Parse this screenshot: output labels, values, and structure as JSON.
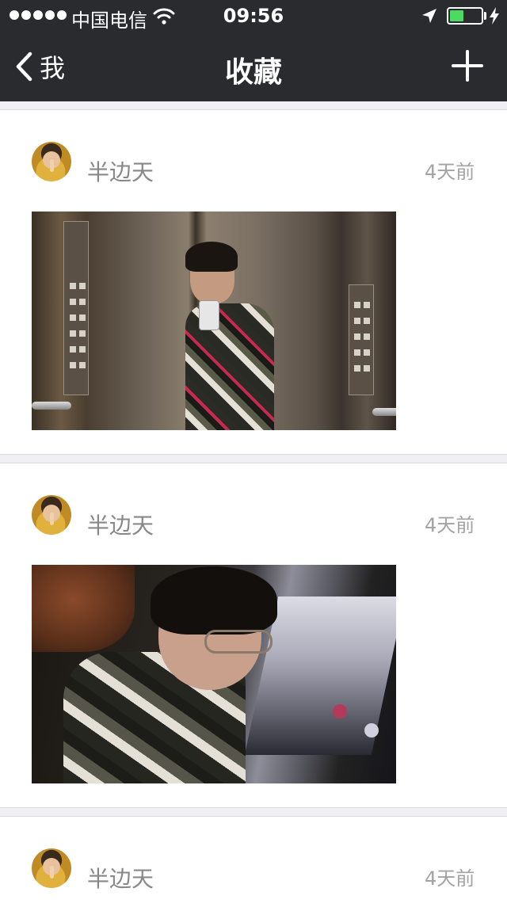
{
  "status_bar": {
    "carrier": "中国电信",
    "time": "09:56",
    "battery_level": 0.45,
    "battery_color": "#4cd964"
  },
  "nav": {
    "back_label": "我",
    "title": "收藏",
    "add_icon": "plus-icon"
  },
  "feed": {
    "items": [
      {
        "user": "半边天",
        "time": "4天前",
        "photo": "elevator-selfie"
      },
      {
        "user": "半边天",
        "time": "4天前",
        "photo": "car-selfie"
      },
      {
        "user": "半边天",
        "time": "4天前"
      }
    ]
  }
}
